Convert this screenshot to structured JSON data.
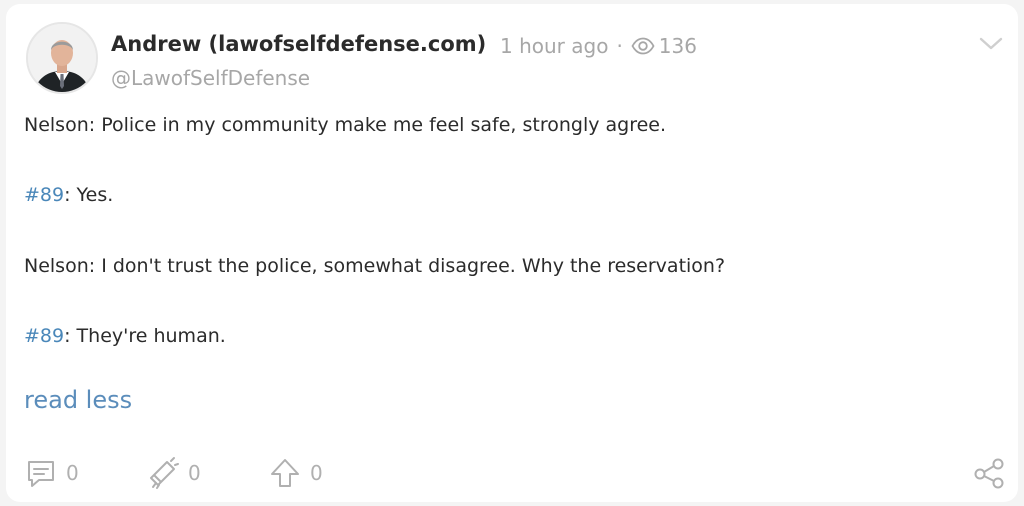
{
  "post": {
    "author_name": "Andrew (lawofselfdefense.com)",
    "time_ago": "1 hour ago",
    "separator": "·",
    "views": "136",
    "handle": "@LawofSelfDefense",
    "lines": [
      {
        "text": "Nelson: Police in my community make me feel safe, strongly agree."
      },
      {
        "tag": "#89",
        "text": ": Yes."
      },
      {
        "text": "Nelson: I don't trust the police, somewhat disagree. Why the reservation?"
      },
      {
        "tag": "#89",
        "text": ": They're human."
      }
    ],
    "read_less": "read less"
  },
  "actions": {
    "comments": "0",
    "flags": "0",
    "upvotes": "0"
  },
  "icons": {
    "avatar": "author-avatar",
    "views": "eye-icon",
    "menu": "chevron-down-icon",
    "comment": "comment-icon",
    "flag": "megaphone-icon",
    "upvote": "upvote-arrow-icon",
    "share": "share-icon"
  },
  "colors": {
    "text": "#2b2b2b",
    "muted": "#a7a7a7",
    "link": "#4a87b9",
    "icon": "#b0b0b0"
  }
}
